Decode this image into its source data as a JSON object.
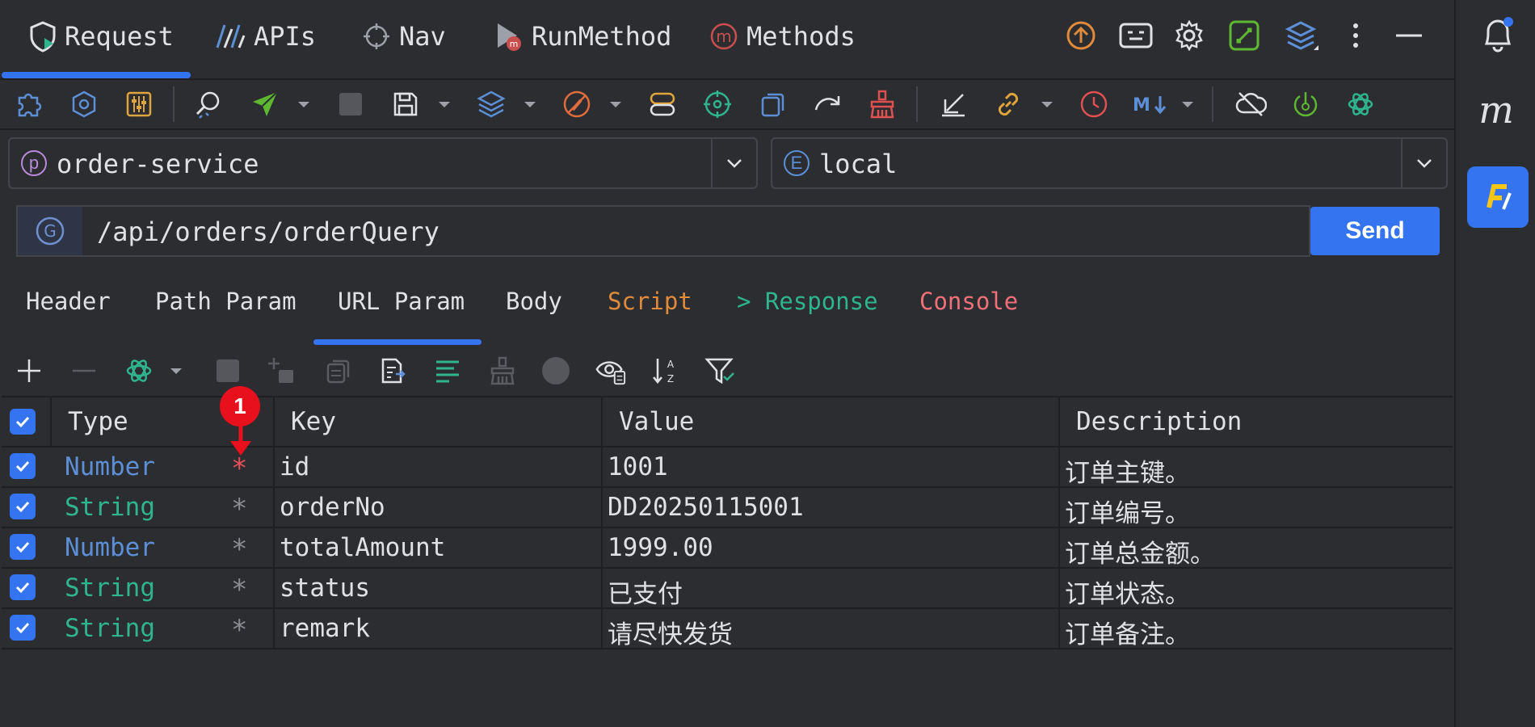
{
  "top_tabs": [
    {
      "label": "Request",
      "icon": "shield-play-icon"
    },
    {
      "label": "APIs",
      "icon": "chart-lines-icon"
    },
    {
      "label": "Nav",
      "icon": "crosshair-icon"
    },
    {
      "label": "RunMethod",
      "icon": "run-method-icon"
    },
    {
      "label": "Methods",
      "icon": "methods-m-icon"
    }
  ],
  "project": {
    "badge": "p",
    "value": "order-service"
  },
  "environment": {
    "badge": "E",
    "value": "local"
  },
  "request": {
    "method_badge": "G",
    "url": "/api/orders/orderQuery",
    "send_label": "Send"
  },
  "param_tabs": [
    {
      "label": "Header",
      "color": "#dfe1e5"
    },
    {
      "label": "Path Param",
      "color": "#dfe1e5"
    },
    {
      "label": "URL Param",
      "color": "#dfe1e5",
      "active": true
    },
    {
      "label": "Body",
      "color": "#dfe1e5"
    },
    {
      "label": "Script",
      "color": "#e08a3c"
    },
    {
      "label": "> Response",
      "color": "#2fb58d"
    },
    {
      "label": "Console",
      "color": "#f0707a"
    }
  ],
  "table": {
    "headers": {
      "type": "Type",
      "key": "Key",
      "value": "Value",
      "description": "Description"
    },
    "rows": [
      {
        "type": "Number",
        "required_mark": "*",
        "key": "id",
        "value": "1001",
        "description": "订单主键。",
        "checked": true
      },
      {
        "type": "String",
        "required_mark": "*",
        "key": "orderNo",
        "value": "DD20250115001",
        "description": "订单编号。",
        "checked": true
      },
      {
        "type": "Number",
        "required_mark": "*",
        "key": "totalAmount",
        "value": "1999.00",
        "description": "订单总金额。",
        "checked": true
      },
      {
        "type": "String",
        "required_mark": "*",
        "key": "status",
        "value": "已支付",
        "description": "订单状态。",
        "checked": true
      },
      {
        "type": "String",
        "required_mark": "*",
        "key": "remark",
        "value": "请尽快发货",
        "description": "订单备注。",
        "checked": true
      }
    ]
  },
  "annotation": {
    "label": "1"
  },
  "colors": {
    "accent": "#3574f0",
    "number_type": "#5c8fd6",
    "string_type": "#2fb58d",
    "required_red": "#e8505b"
  }
}
